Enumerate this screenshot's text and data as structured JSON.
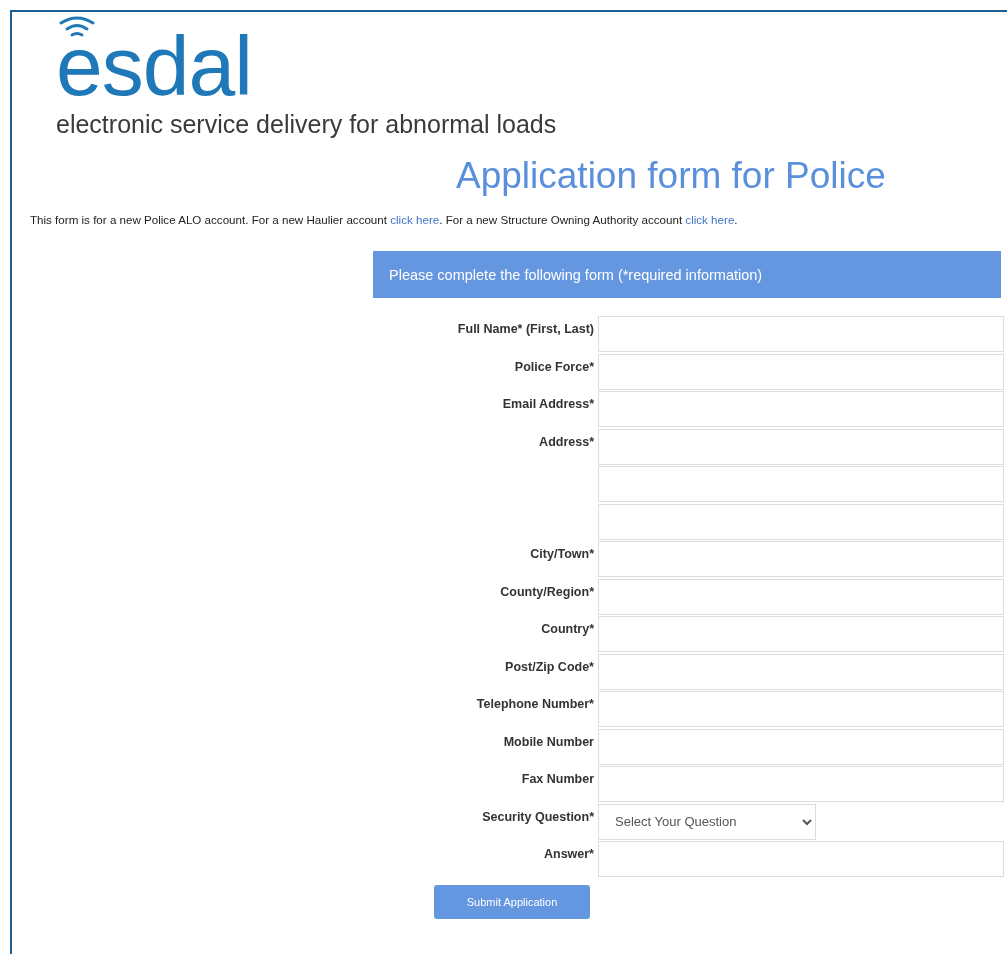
{
  "logo": {
    "wordmark": "esdal",
    "tagline": "electronic service delivery for abnormal loads"
  },
  "title": "Application form for Police",
  "intro": {
    "parts": [
      {
        "kind": "text",
        "text": "This form is for a new Police ALO account. For a new Haulier account "
      },
      {
        "kind": "link",
        "text": "click here"
      },
      {
        "kind": "text",
        "text": ". For a new Structure Owning Authority account "
      },
      {
        "kind": "link",
        "text": "click here"
      },
      {
        "kind": "text",
        "text": "."
      }
    ]
  },
  "form": {
    "header": "Please complete the following form (*required information)",
    "rows": [
      {
        "label": "Full Name* (First, Last)",
        "kind": "text"
      },
      {
        "label": "Police Force*",
        "kind": "text"
      },
      {
        "label": "Email Address*",
        "kind": "text"
      },
      {
        "label": "Address*",
        "kind": "text"
      },
      {
        "kind": "text"
      },
      {
        "kind": "text"
      },
      {
        "label": "City/Town*",
        "kind": "text"
      },
      {
        "label": "County/Region*",
        "kind": "text"
      },
      {
        "label": "Country*",
        "kind": "text"
      },
      {
        "label": "Post/Zip Code*",
        "kind": "text"
      },
      {
        "label": "Telephone Number*",
        "kind": "text"
      },
      {
        "label": "Mobile Number",
        "kind": "text"
      },
      {
        "label": "Fax Number",
        "kind": "text"
      },
      {
        "label": "Security Question*",
        "kind": "select",
        "value": "Select Your Question"
      },
      {
        "label": "Answer*",
        "kind": "text"
      }
    ],
    "submit": "Submit Application"
  }
}
